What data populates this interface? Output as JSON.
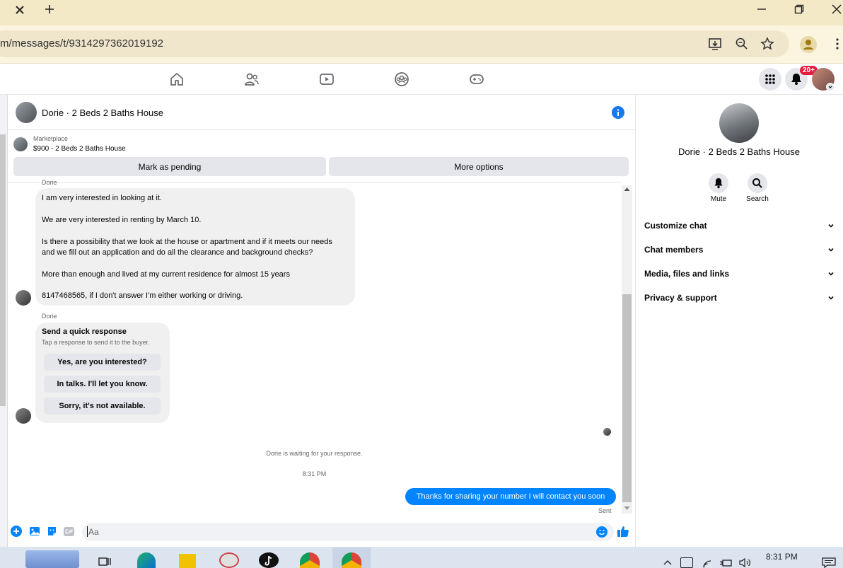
{
  "browser": {
    "url": "m/messages/t/9314297362019192"
  },
  "fb_nav": {
    "notification_count": "20+"
  },
  "chat": {
    "title": "Dorie · 2 Beds 2 Baths House",
    "marketplace_label": "Marketplace",
    "listing": "$900 - 2 Beds 2 Baths House",
    "mark_pending_label": "Mark as pending",
    "more_options_label": "More options",
    "sender_name_top": "Dorie",
    "message_lines": [
      "I am very interested in looking at it.",
      "We are very interested in renting by March 10.",
      "Is there a possibility that we look at the house or apartment and if it meets our needs",
      "and we fill out an application and do all the clearance and background checks?",
      "More than enough and lived at my current residence for almost 15 years",
      "8147468565, if I don't answer I'm either working or driving."
    ],
    "sender_name": "Dorie",
    "quick_response": {
      "title": "Send a quick response",
      "subtitle": "Tap a response to send it to the buyer.",
      "options": [
        "Yes, are you interested?",
        "In talks. I'll let you know.",
        "Sorry, it's not available."
      ]
    },
    "waiting_text": "Dorie is waiting for your response.",
    "timestamp": "8:31 PM",
    "sent_message": "Thanks for sharing your number I will contact you soon",
    "sent_status": "Sent",
    "input_placeholder": "Aa"
  },
  "right_panel": {
    "title": "Dorie · 2 Beds 2 Baths House",
    "mute_label": "Mute",
    "search_label": "Search",
    "sections": [
      "Customize chat",
      "Chat members",
      "Media, files and links",
      "Privacy & support"
    ]
  },
  "taskbar": {
    "time": "8:31 PM"
  },
  "colors": {
    "messenger_blue": "#0084ff",
    "fb_blue": "#1877f2",
    "tab_bar": "#f4e9c6"
  }
}
